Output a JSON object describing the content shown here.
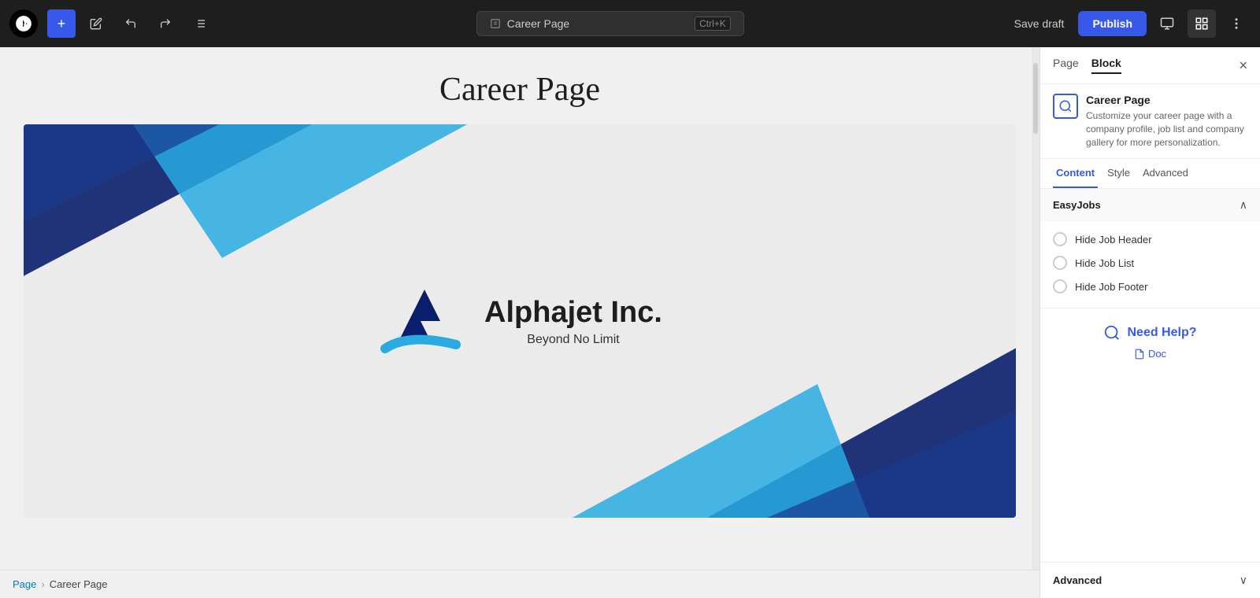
{
  "toolbar": {
    "add_label": "+",
    "edit_icon": "✎",
    "undo_icon": "↩",
    "redo_icon": "↪",
    "list_icon": "☰",
    "search_placeholder": "Career Page",
    "search_shortcut": "Ctrl+K",
    "save_draft_label": "Save draft",
    "publish_label": "Publish",
    "view_icon": "□",
    "settings_icon": "⊞",
    "more_icon": "⋮"
  },
  "panel": {
    "tab_page": "Page",
    "tab_block": "Block",
    "active_tab": "Block",
    "close_icon": "×",
    "block_name": "Career Page",
    "block_description": "Customize your career page with a company profile, job list and company gallery for more personalization.",
    "content_tabs": [
      "Content",
      "Style",
      "Advanced"
    ],
    "active_content_tab": "Content",
    "section_easyjobs": "EasyJobs",
    "toggle_hide_job_header": "Hide Job Header",
    "toggle_hide_job_list": "Hide Job List",
    "toggle_hide_job_footer": "Hide Job Footer",
    "need_help_title": "Need Help?",
    "doc_label": "Doc",
    "advanced_label": "Advanced",
    "chevron_up": "∧",
    "chevron_down": "∨"
  },
  "canvas": {
    "page_title": "Career Page",
    "company_name": "Alphajet Inc.",
    "company_tagline": "Beyond No Limit"
  },
  "breadcrumb": {
    "items": [
      "Page",
      "Career Page"
    ],
    "separator": "›"
  },
  "block_toolbar": {
    "search_icon": "⊕",
    "align_icon": "≡",
    "more_icon": "⋯"
  }
}
